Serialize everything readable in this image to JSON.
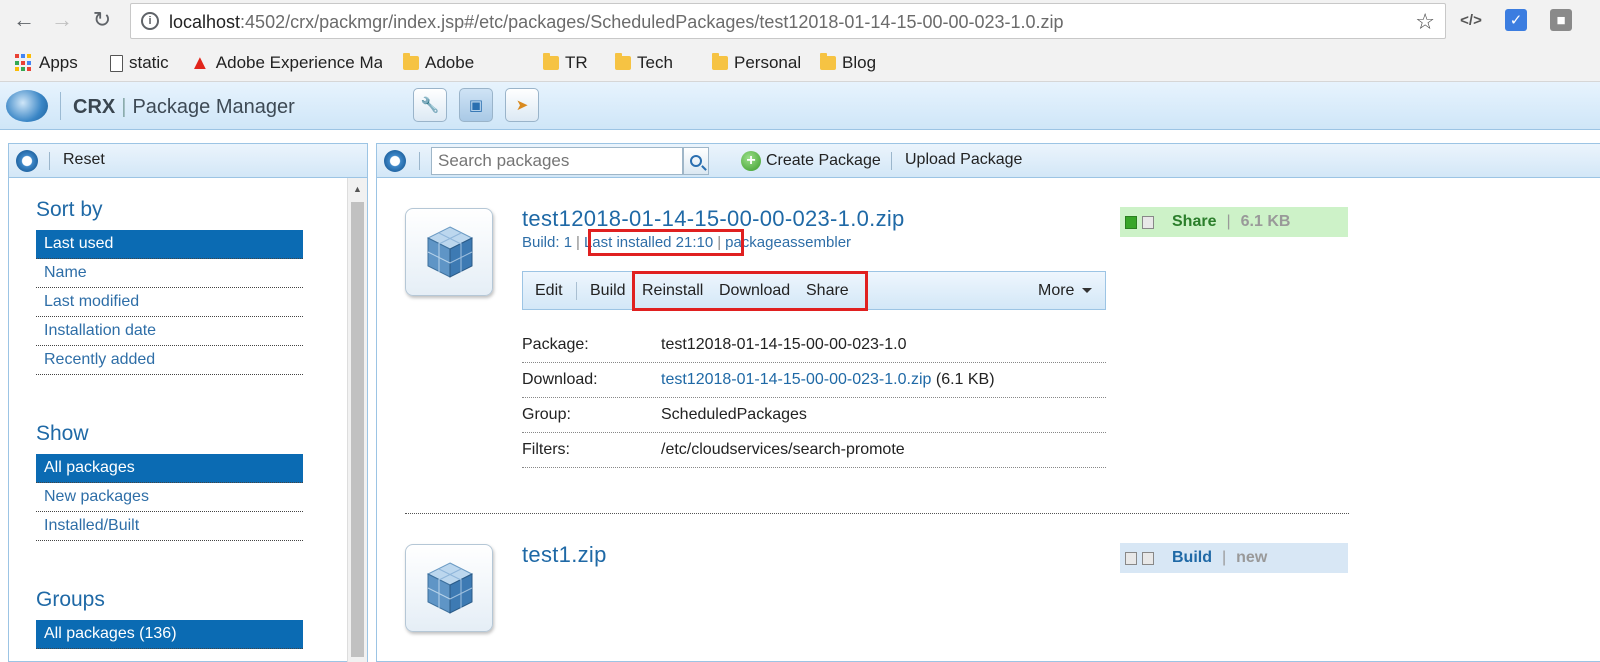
{
  "browser": {
    "url_host": "localhost",
    "url_rest": ":4502/crx/packmgr/index.jsp#/etc/packages/ScheduledPackages/test12018-01-14-15-00-00-023-1.0.zip",
    "bookmarks": [
      "Apps",
      "static",
      "Adobe Experience Ma",
      "Adobe",
      "TR",
      "Tech",
      "Personal",
      "Blog"
    ]
  },
  "app": {
    "brand": "CRX",
    "title": "Package Manager"
  },
  "left": {
    "reset_label": "Reset",
    "sort_title": "Sort by",
    "sort_items": [
      "Last used",
      "Name",
      "Last modified",
      "Installation date",
      "Recently added"
    ],
    "show_title": "Show",
    "show_items": [
      "All packages",
      "New packages",
      "Installed/Built"
    ],
    "groups_title": "Groups",
    "group_items": [
      "All packages (136)"
    ]
  },
  "toolbar": {
    "search_placeholder": "Search packages",
    "create_label": "Create Package",
    "upload_label": "Upload Package"
  },
  "packages": [
    {
      "title": "test12018-01-14-15-00-00-023-1.0.zip",
      "build": "Build: 1",
      "last_installed": "Last installed 21:10",
      "author": "packageassembler",
      "status": "Share",
      "size": "6.1 KB",
      "actions": [
        "Edit",
        "Build",
        "Reinstall",
        "Download",
        "Share",
        "More"
      ],
      "details": [
        {
          "label": "Package:",
          "value": "test12018-01-14-15-00-00-023-1.0"
        },
        {
          "label": "Download:",
          "value": "test12018-01-14-15-00-00-023-1.0.zip",
          "extra": "(6.1 KB)"
        },
        {
          "label": "Group:",
          "value": "ScheduledPackages"
        },
        {
          "label": "Filters:",
          "value": "/etc/cloudservices/search-promote"
        }
      ]
    },
    {
      "title": "test1.zip",
      "status": "Build",
      "size": "new"
    }
  ]
}
